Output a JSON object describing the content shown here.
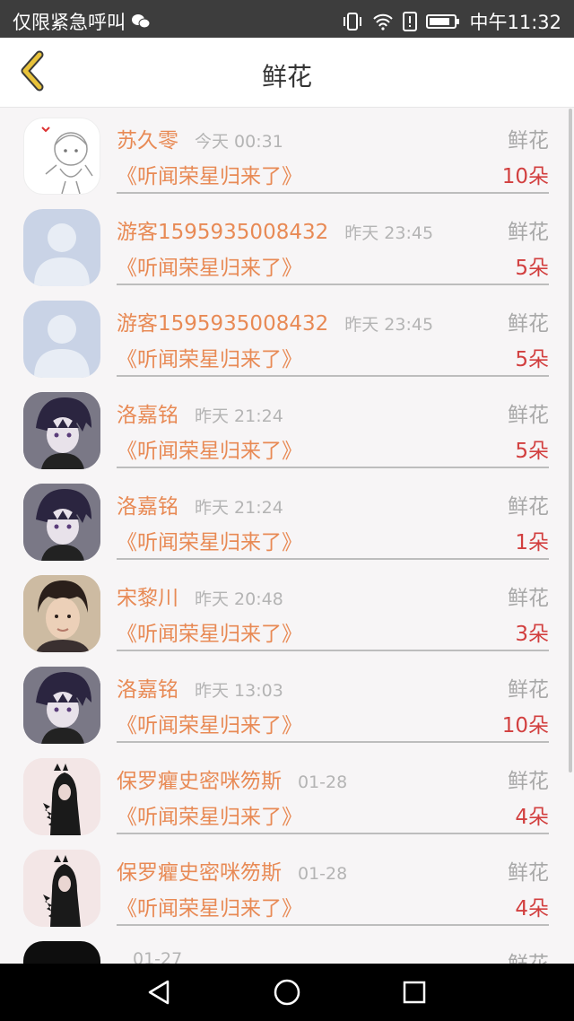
{
  "status_bar": {
    "left_text": "仅限紧急呼叫",
    "clock": "中午11:32",
    "icons": [
      "wechat-icon",
      "vibrate-icon",
      "wifi-icon",
      "alert-icon",
      "battery-icon"
    ]
  },
  "header": {
    "title": "鲜花",
    "back_icon": "chevron-left-icon"
  },
  "list": [
    {
      "name": "苏久零",
      "time": "今天 00:31",
      "kind": "鲜花",
      "book": "《听闻荣星归来了》",
      "count": "10朵",
      "avatar": "sketch"
    },
    {
      "name": "游客1595935008432",
      "time": "昨天 23:45",
      "kind": "鲜花",
      "book": "《听闻荣星归来了》",
      "count": "5朵",
      "avatar": "default"
    },
    {
      "name": "游客1595935008432",
      "time": "昨天 23:45",
      "kind": "鲜花",
      "book": "《听闻荣星归来了》",
      "count": "5朵",
      "avatar": "default"
    },
    {
      "name": "洛嘉铭",
      "time": "昨天 21:24",
      "kind": "鲜花",
      "book": "《听闻荣星归来了》",
      "count": "5朵",
      "avatar": "anime"
    },
    {
      "name": "洛嘉铭",
      "time": "昨天 21:24",
      "kind": "鲜花",
      "book": "《听闻荣星归来了》",
      "count": "1朵",
      "avatar": "anime"
    },
    {
      "name": "宋黎川",
      "time": "昨天 20:48",
      "kind": "鲜花",
      "book": "《听闻荣星归来了》",
      "count": "3朵",
      "avatar": "photo"
    },
    {
      "name": "洛嘉铭",
      "time": "昨天 13:03",
      "kind": "鲜花",
      "book": "《听闻荣星归来了》",
      "count": "10朵",
      "avatar": "anime"
    },
    {
      "name": "保罗癯史密咪笏斯",
      "time": "01-28",
      "kind": "鲜花",
      "book": "《听闻荣星归来了》",
      "count": "4朵",
      "avatar": "hood"
    },
    {
      "name": "保罗癯史密咪笏斯",
      "time": "01-28",
      "kind": "鲜花",
      "book": "《听闻荣星归来了》",
      "count": "4朵",
      "avatar": "hood"
    },
    {
      "name": "",
      "time": "01-27",
      "kind": "鲜花",
      "book": "",
      "count": "",
      "avatar": "dark"
    }
  ],
  "nav_bar": {
    "icons": [
      "back-triangle-icon",
      "home-circle-icon",
      "recents-square-icon"
    ]
  },
  "colors": {
    "accent": "#e88a55",
    "count": "#d23f3f",
    "back_arrow": "#e8c23a"
  }
}
